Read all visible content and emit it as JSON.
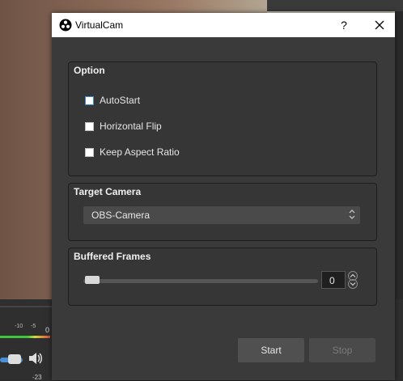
{
  "background": {
    "meter_ticks": [
      "-10",
      "-5"
    ],
    "meter_zero": "0",
    "volume_db": "-23"
  },
  "dialog": {
    "title": "VirtualCam",
    "help_label": "?",
    "close_label": "✕"
  },
  "option_group": {
    "title": "Option",
    "autostart_label": "AutoStart",
    "horizontal_flip_label": "Horizontal Flip",
    "keep_aspect_label": "Keep Aspect Ratio"
  },
  "target_camera_group": {
    "title": "Target Camera",
    "selected": "OBS-Camera"
  },
  "buffered_frames_group": {
    "title": "Buffered Frames",
    "value": "0",
    "slider_fraction": 0
  },
  "buttons": {
    "start_label": "Start",
    "stop_label": "Stop"
  },
  "colors": {
    "dialog_bg": "#3a3a3a",
    "titlebar_bg": "#ffffff",
    "focus_accent": "#3c88d6"
  }
}
